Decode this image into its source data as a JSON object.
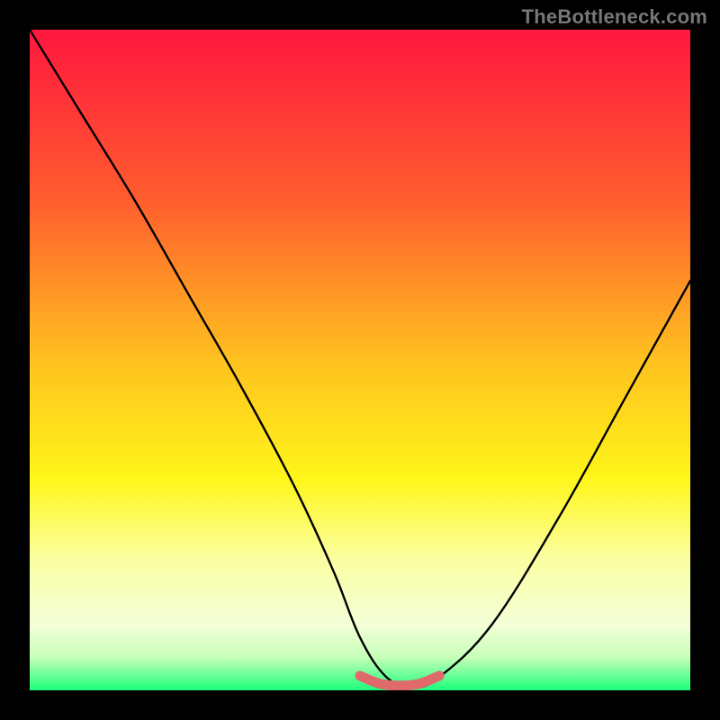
{
  "watermark": "TheBottleneck.com",
  "chart_data": {
    "type": "line",
    "title": "",
    "xlabel": "",
    "ylabel": "",
    "xlim": [
      0,
      100
    ],
    "ylim": [
      0,
      100
    ],
    "series": [
      {
        "name": "bottleneck-curve",
        "x": [
          0,
          8,
          16,
          24,
          32,
          40,
          46,
          50,
          54,
          58,
          62,
          70,
          80,
          90,
          100
        ],
        "y": [
          100,
          87,
          74,
          60,
          46,
          31,
          18,
          8,
          2,
          0.5,
          2,
          10,
          26,
          44,
          62
        ]
      },
      {
        "name": "red-highlight",
        "x": [
          50,
          53,
          56,
          59,
          62
        ],
        "y": [
          2.2,
          1.0,
          0.7,
          1.0,
          2.2
        ]
      }
    ],
    "gradient_stops": [
      {
        "offset": 0,
        "color": "#ff173f"
      },
      {
        "offset": 25,
        "color": "#ff5a2e"
      },
      {
        "offset": 50,
        "color": "#ffc11f"
      },
      {
        "offset": 68,
        "color": "#fff61a"
      },
      {
        "offset": 80,
        "color": "#fbffa0"
      },
      {
        "offset": 90,
        "color": "#f4ffd8"
      },
      {
        "offset": 95,
        "color": "#c7ffb8"
      },
      {
        "offset": 100,
        "color": "#1cff7c"
      }
    ]
  }
}
